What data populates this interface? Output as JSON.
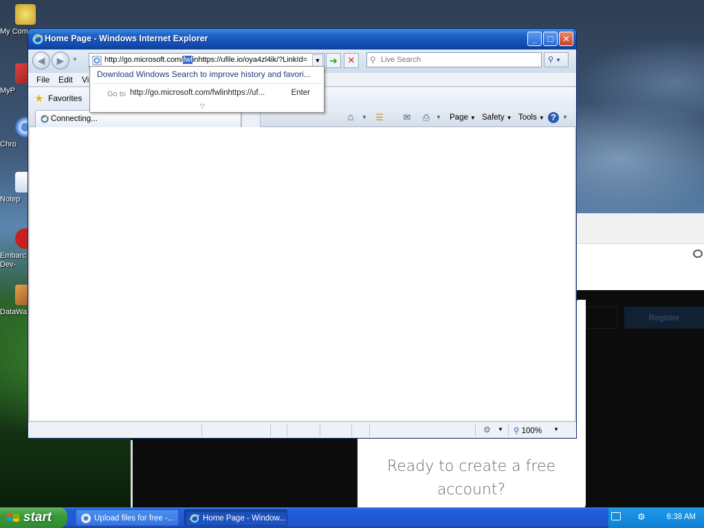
{
  "desktop": {
    "icons": [
      {
        "label": "My Com",
        "color": "#e8d84a"
      },
      {
        "label": "MyP",
        "color": "#c03030"
      },
      {
        "label": "Chro",
        "color": "#2f7de0"
      },
      {
        "label": "Notep",
        "color": "#5aaa5a"
      },
      {
        "label": "Embarc Dev-",
        "color": "#cc2020"
      },
      {
        "label": "DataWa",
        "color": "#c87a30"
      }
    ]
  },
  "background_page": {
    "register_label": "Register",
    "ready_line1": "Ready to create a free",
    "ready_line2": "account?"
  },
  "window": {
    "title": "Home Page - Windows Internet Explorer",
    "buttons": {
      "minimize": "_",
      "maximize": "□",
      "close": "✕"
    }
  },
  "navigation": {
    "address_prefix": "http://go.microsoft.com/",
    "address_highlight": "fwl",
    "address_suffix": "inhttps://ufile.io/oya4zl4ik/?LinkId=",
    "search_placeholder": "Live Search"
  },
  "autocomplete": {
    "suggestion": "Download Windows Search to improve history and favori...",
    "goto_label": "Go to",
    "goto_url": "http://go.microsoft.com/fwlinhttps://uf...",
    "enter_label": "Enter"
  },
  "menubar": {
    "items": [
      "File",
      "Edit",
      "Vi"
    ]
  },
  "favorites_bar": {
    "label": "Favorites"
  },
  "tab": {
    "label": "Connecting..."
  },
  "command_bar": {
    "page": "Page",
    "safety": "Safety",
    "tools": "Tools"
  },
  "statusbar": {
    "zoom": "100%"
  },
  "taskbar": {
    "start_label": "start",
    "tasks": [
      {
        "label": "Upload files for free -...",
        "active": false
      },
      {
        "label": "Home Page - Window...",
        "active": true
      }
    ],
    "clock": "6:38 AM"
  }
}
